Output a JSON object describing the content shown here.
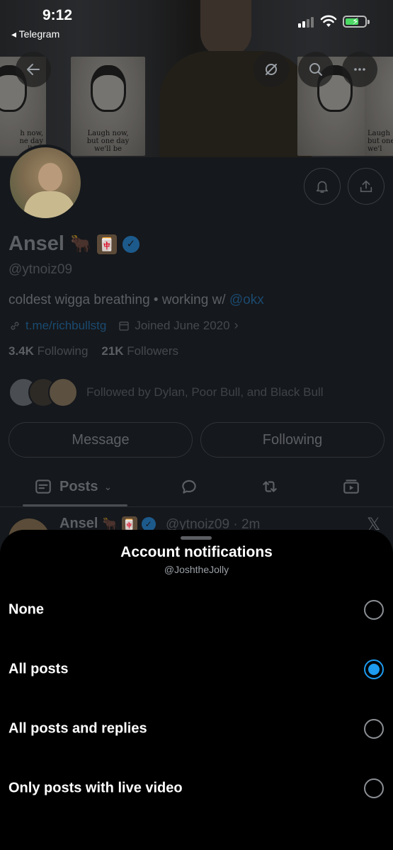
{
  "status_bar": {
    "time": "9:12",
    "back_app": "◂ Telegram"
  },
  "banner": {
    "poster_caption_left": "h now,\nne day\nll be",
    "poster_caption_mid": "Laugh now,\nbut one day\nwe'll be",
    "poster_caption_right": "Laugh\nbut one\nwe'l"
  },
  "profile": {
    "name": "Ansel",
    "emoji_1": "🐂",
    "emoji_2": "🀄",
    "handle": "@ytnoiz09",
    "bio_text": "coldest wigga breathing • working w/",
    "bio_mention": "@okx",
    "link": "t.me/richbullstg",
    "joined": "Joined June 2020",
    "following_count": "3.4K",
    "following_label": "Following",
    "followers_count": "21K",
    "followers_label": "Followers",
    "followed_by": "Followed by Dylan, Poor Bull, and Black Bull"
  },
  "actions": {
    "message": "Message",
    "following": "Following"
  },
  "tabs": {
    "posts": "Posts"
  },
  "post": {
    "name": "Ansel",
    "handle_time": "@ytnoiz09 · 2m"
  },
  "sheet": {
    "title": "Account notifications",
    "subtitle": "@JoshtheJolly",
    "options": [
      {
        "label": "None",
        "selected": false
      },
      {
        "label": "All posts",
        "selected": true
      },
      {
        "label": "All posts and replies",
        "selected": false
      },
      {
        "label": "Only posts with live video",
        "selected": false
      }
    ]
  },
  "colors": {
    "accent": "#1d9bf0",
    "sheet_bg": "#000000",
    "page_bg": "#15181c"
  }
}
